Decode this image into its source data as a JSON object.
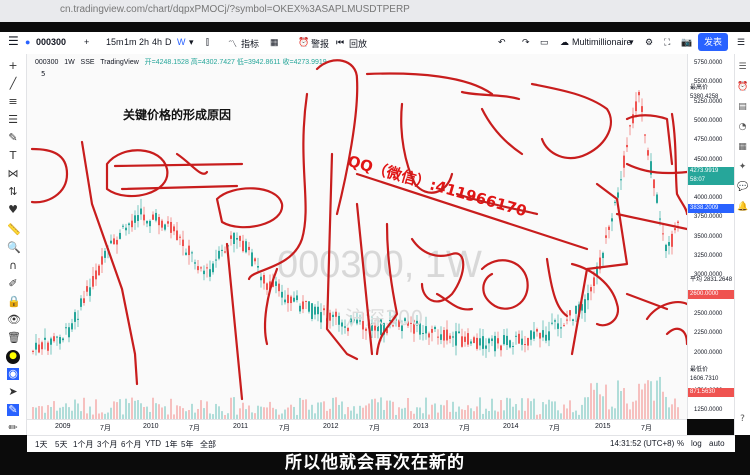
{
  "browser": {
    "url": "cn.tradingview.com/chart/dqpxPMOCj/?symbol=OKEX%3ASAPLMUSDTPERP"
  },
  "toolbar": {
    "symbol": "000300",
    "add": "+",
    "intervals": [
      "15m",
      "1m",
      "2h",
      "4h",
      "D",
      "W"
    ],
    "interval_dropdown": "▾",
    "indicators": "指标",
    "alert": "警报",
    "replay": "回放",
    "layout_name": "Multimillionaire",
    "publish": "发表"
  },
  "legend": {
    "symbol": "000300",
    "interval": "1W",
    "exchange": "SSE",
    "source": "TradingView",
    "ohlc": "开=4248.1528 高=4302.7427 低=3942.8611 收=4273.9919",
    "sub": "5"
  },
  "chart": {
    "watermark": "000300, 1W",
    "watermark2": "沪深300",
    "annotation_title": "关键价格的形成原因",
    "qq_text": "QQ（微信）:411966170",
    "colors": {
      "up": "#26a69a",
      "down": "#ef5350",
      "ink": "#c81d1d",
      "accent": "#2962ff"
    }
  },
  "price_axis": {
    "ticks": [
      "5750.0000",
      "5500.0000",
      "5250.0000",
      "5000.0000",
      "4750.0000",
      "4500.0000",
      "4250.0000",
      "4000.0000",
      "3750.0000",
      "3500.0000",
      "3250.0000",
      "3000.0000",
      "2750.0000",
      "2500.0000",
      "2250.0000",
      "2000.0000",
      "1750.0000",
      "1500.0000",
      "1250.0000"
    ],
    "labels": [
      {
        "name": "最高价",
        "value": "5380.4258"
      },
      {
        "name": "",
        "value": "4273.9919"
      },
      {
        "name": "",
        "value": "58:07"
      },
      {
        "name": "",
        "value": "3838.2009"
      },
      {
        "name": "平均",
        "value": "2831.2648"
      },
      {
        "name": "",
        "value": "2600.0000"
      },
      {
        "name": "最低价",
        "value": "1606.7310"
      },
      {
        "name": "",
        "value": "871.5630"
      }
    ]
  },
  "time_axis": {
    "labels": [
      "2009",
      "7月",
      "2010",
      "7月",
      "2011",
      "7月",
      "2012",
      "7月",
      "2013",
      "7月",
      "2014",
      "7月",
      "2015",
      "7月"
    ]
  },
  "bottom_bar": {
    "ranges": [
      "1天",
      "5天",
      "1个月",
      "3个月",
      "6个月",
      "YTD",
      "1年",
      "5年",
      "全部"
    ],
    "time": "14:31:52 (UTC+8)",
    "percent": "%",
    "log": "log",
    "auto": "auto"
  },
  "caption": "所以他就会再次在新的"
}
